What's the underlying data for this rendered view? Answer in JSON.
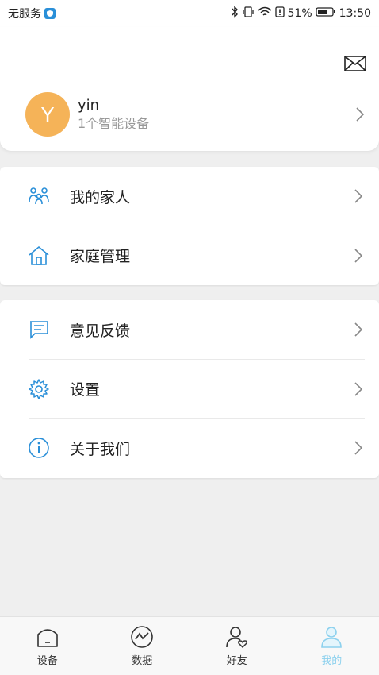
{
  "status_bar": {
    "carrier": "无服务",
    "battery_percent": "51%",
    "time": "13:50"
  },
  "profile": {
    "avatar_letter": "Y",
    "name": "yin",
    "subtitle": "1个智能设备"
  },
  "menu_group_1": [
    {
      "label": "我的家人",
      "icon": "family-icon"
    },
    {
      "label": "家庭管理",
      "icon": "home-icon"
    }
  ],
  "menu_group_2": [
    {
      "label": "意见反馈",
      "icon": "feedback-icon"
    },
    {
      "label": "设置",
      "icon": "gear-icon"
    },
    {
      "label": "关于我们",
      "icon": "info-icon"
    }
  ],
  "tabs": [
    {
      "label": "设备",
      "icon": "device-icon"
    },
    {
      "label": "数据",
      "icon": "chart-icon"
    },
    {
      "label": "好友",
      "icon": "friends-icon"
    },
    {
      "label": "我的",
      "icon": "person-icon",
      "active": true
    }
  ],
  "colors": {
    "accent": "#2a8fd8",
    "avatar": "#f5b358",
    "active_tab": "#8dd1ee"
  }
}
